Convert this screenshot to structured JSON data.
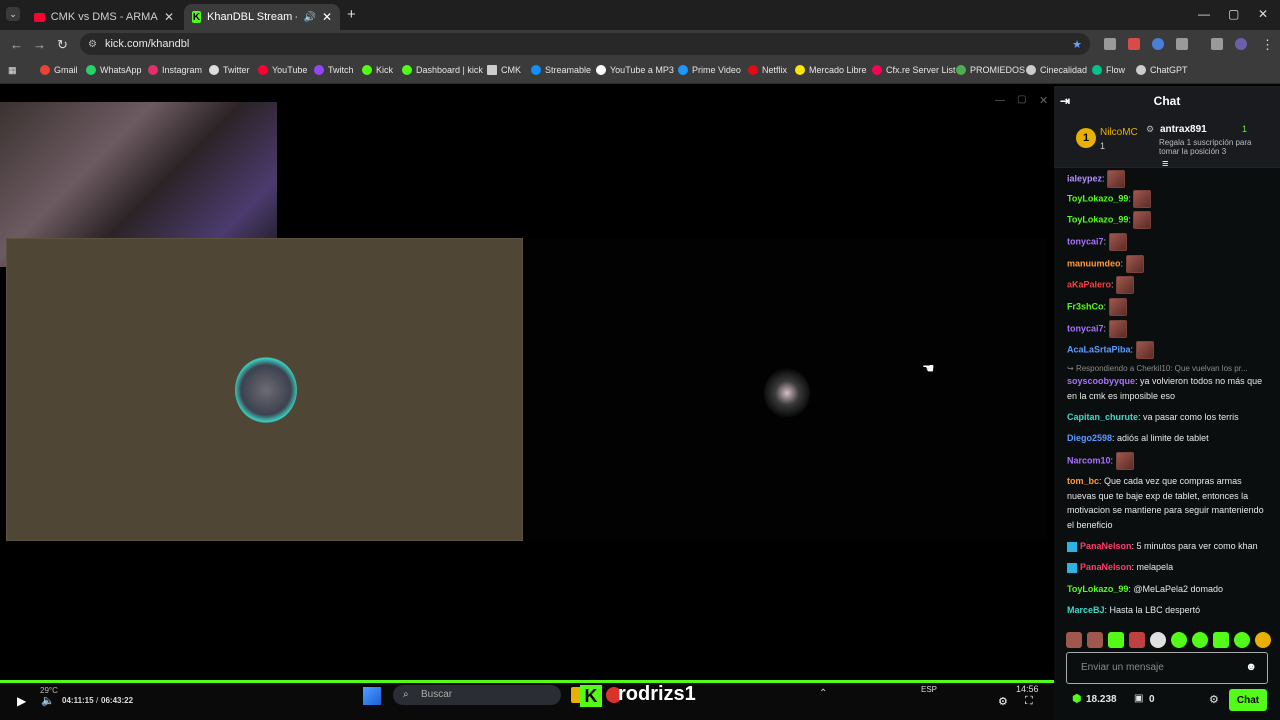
{
  "browser": {
    "tabs": [
      {
        "title": "CMK vs DMS - ARMAS LARGAS",
        "close": "✕"
      },
      {
        "title": "KhanDBL Stream - Watch L",
        "close": "✕"
      }
    ],
    "new_tab": "+",
    "url": "kick.com/khandbl",
    "window_controls": {
      "minimize": "—",
      "maximize": "▢",
      "close": "✕"
    }
  },
  "bookmarks": [
    {
      "label": "Gmail",
      "color": "#ea4335"
    },
    {
      "label": "WhatsApp",
      "color": "#25d366"
    },
    {
      "label": "Instagram",
      "color": "#e1306c"
    },
    {
      "label": "Twitter",
      "color": "#dddddd"
    },
    {
      "label": "YouTube",
      "color": "#ff0033"
    },
    {
      "label": "Twitch",
      "color": "#9146ff"
    },
    {
      "label": "Kick",
      "color": "#53fc18"
    },
    {
      "label": "Dashboard | kick",
      "color": "#53fc18"
    },
    {
      "label": "CMK",
      "color": "#cccccc"
    },
    {
      "label": "Streamable",
      "color": "#0f90fa"
    },
    {
      "label": "YouTube a MP3",
      "color": "#ffffff"
    },
    {
      "label": "Prime Video",
      "color": "#1a98ff"
    },
    {
      "label": "Netflix",
      "color": "#e50914"
    },
    {
      "label": "Mercado Libre",
      "color": "#ffe600"
    },
    {
      "label": "Cfx.re Server List",
      "color": "#f40552"
    },
    {
      "label": "PROMIEDOS",
      "color": "#4caf50"
    },
    {
      "label": "Cinecalidad",
      "color": "#cccccc"
    },
    {
      "label": "Flow",
      "color": "#00c389"
    },
    {
      "label": "ChatGPT",
      "color": "#cccccc"
    }
  ],
  "player": {
    "time_current": "04:11:15",
    "time_total": "06:43:22",
    "streamer": "rodrizs1",
    "taskbar": {
      "search": "Buscar",
      "temp": "29°C",
      "lang": "ESP",
      "clock": "14:56"
    }
  },
  "chat": {
    "title": "Chat",
    "pinned": {
      "rank": "1",
      "leader": "NilcoMC",
      "leader_count": "1",
      "user": "antrax891",
      "user_count": "1",
      "gift_text": "Regala 1 suscripción para tomar la posición 3"
    },
    "messages": [
      {
        "user": "ialeypez",
        "color": "#b78fff",
        "text": "",
        "emote": true
      },
      {
        "user": "ToyLokazo_99",
        "color": "#53fc18",
        "text": "",
        "emote": true
      },
      {
        "user": "ToyLokazo_99",
        "color": "#53fc18",
        "text": "",
        "emote": true
      },
      {
        "user": "tonycai7",
        "color": "#a970ff",
        "text": "",
        "emote": true
      },
      {
        "user": "manuumdeo",
        "color": "#ff9a3c",
        "text": "",
        "emote": true
      },
      {
        "user": "aKaPalero",
        "color": "#ff3b3b",
        "text": "",
        "emote": true
      },
      {
        "user": "Fr3shCo",
        "color": "#53fc18",
        "text": "",
        "emote": true
      },
      {
        "user": "tonycai7",
        "color": "#a970ff",
        "text": "",
        "emote": true
      },
      {
        "user": "AcaLaSrtaPiba",
        "color": "#5b9bff",
        "text": "",
        "emote": true
      }
    ],
    "reply_note": "Respondiendo a Cherkil10: Que vuelvan los pr...",
    "messages2": [
      {
        "user": "soyscoobyyque",
        "color": "#a970ff",
        "text": "ya volvieron todos no más que en la cmk es imposible eso"
      },
      {
        "user": "Capitan_churute",
        "color": "#3fd8c8",
        "text": "va pasar como los terris"
      },
      {
        "user": "Diego2598",
        "color": "#5b9bff",
        "text": "adiós al limite de tablet"
      },
      {
        "user": "Narcom10",
        "color": "#a970ff",
        "text": "",
        "emote": true
      },
      {
        "user": "tom_bc",
        "color": "#ff9a3c",
        "text": "Que cada vez que compras armas nuevas que te baje exp de tablet, entonces la motivacion se mantiene para seguir manteniendo el beneficio"
      },
      {
        "user": "PanaNelson",
        "color": "#ff3b6b",
        "text": "5 minutos para ver como khan",
        "badge": true
      },
      {
        "user": "PanaNelson",
        "color": "#ff3b6b",
        "text": "melapela",
        "badge": true
      },
      {
        "user": "ToyLokazo_99",
        "color": "#53fc18",
        "text": "@MeLaPela2 domado"
      },
      {
        "user": "MarceBJ",
        "color": "#3fd8c8",
        "text": "Hasta la LBC despertó"
      }
    ],
    "input_placeholder": "Enviar un mensaje",
    "points": "18.238",
    "drops": "0",
    "send_label": "Chat"
  }
}
